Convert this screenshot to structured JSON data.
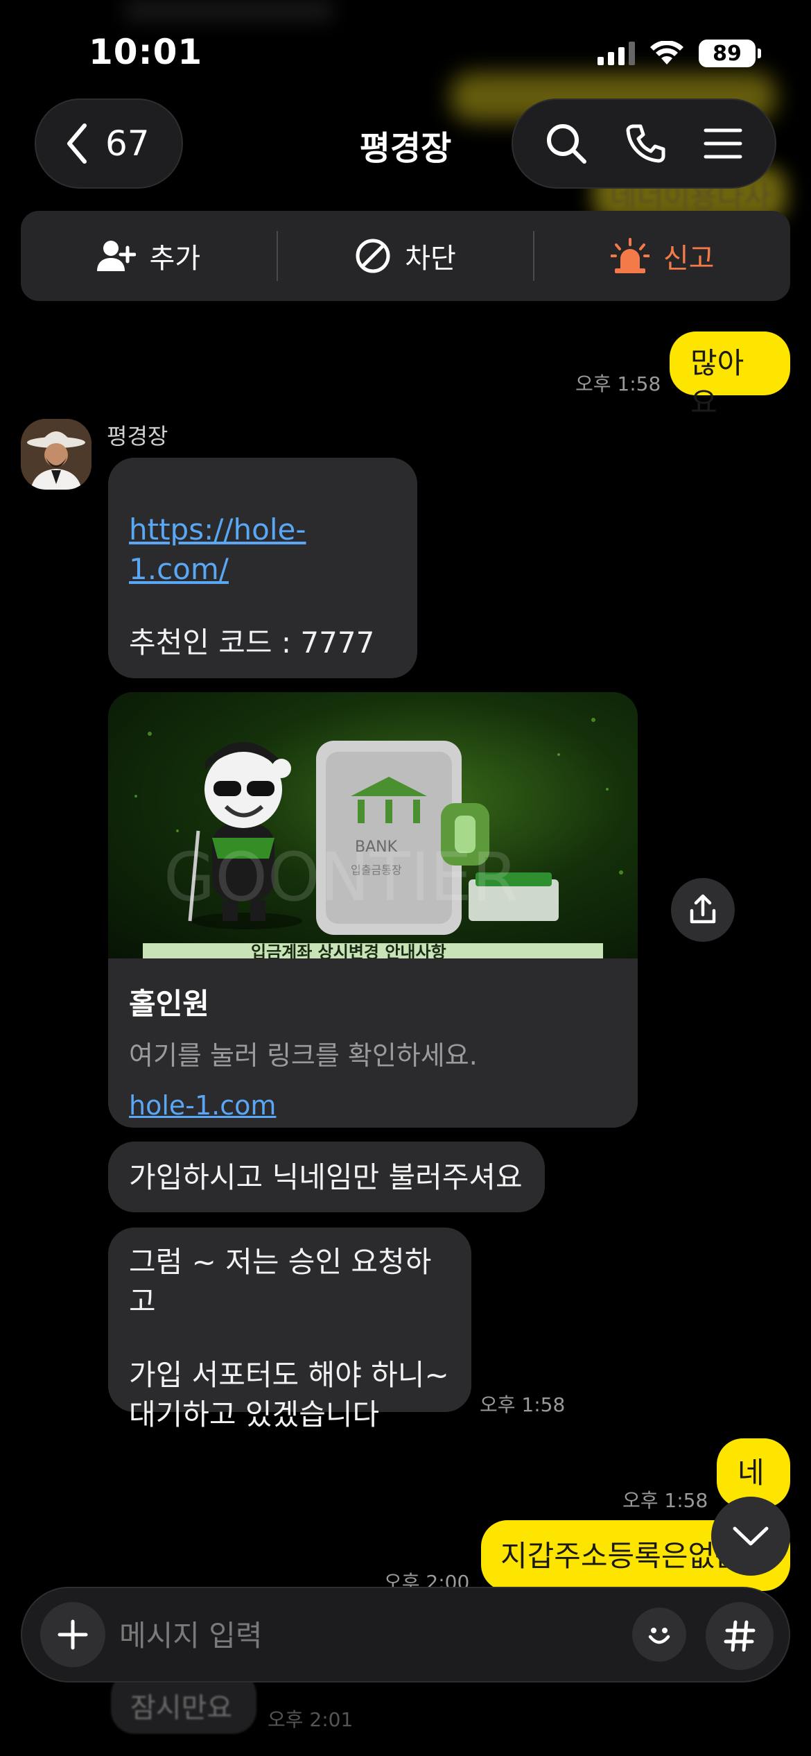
{
  "status_bar": {
    "time": "10:01",
    "battery": "89"
  },
  "header": {
    "back_count": "67",
    "title": "평경장",
    "blurred_text": "데너이용다사"
  },
  "action_bar": {
    "add_label": "추가",
    "block_label": "차단",
    "report_label": "신고"
  },
  "messages": {
    "out_1": {
      "text": "많아요",
      "time": "오후 1:58"
    },
    "sender_name": "평경장",
    "in_1": {
      "link": "https://hole-1.com/",
      "line2": "추천인 코드 :  7777"
    },
    "link_card": {
      "title": "홀인원",
      "description": "여기를 눌러 링크를 확인하세요.",
      "url": "hole-1.com",
      "image_bank_text": "BANK",
      "image_passbook_text": "입출금통장",
      "image_caption": "입금계좌 상시변경 안내사항",
      "image_watermark": "GOONTIER"
    },
    "in_2": {
      "text": "가입하시고 닉네임만 불러주셔요"
    },
    "in_3": {
      "line1": "그럼 ~ 저는 승인 요청하고",
      "line2": "가입 서포터도 해야 하니~",
      "line3": "대기하고 있겠습니다",
      "time": "오후 1:58"
    },
    "out_2": {
      "text": "네",
      "time": "오후 1:58"
    },
    "out_3": {
      "text": "지갑주소등록은없는데",
      "time": "오후 2:00"
    },
    "ghost": {
      "text": "잠시만요",
      "time": "오후 2:01"
    }
  },
  "input": {
    "placeholder": "메시지 입력"
  },
  "colors": {
    "background": "#000000",
    "bubble_in": "#2b2b2d",
    "bubble_out": "#fee500",
    "report_accent": "#f47a4a",
    "link": "#5aa7f5"
  },
  "icons": {
    "back": "chevron-left-icon",
    "search": "search-icon",
    "call": "phone-icon",
    "menu": "menu-icon",
    "add_friend": "add-person-icon",
    "block": "block-icon",
    "report": "siren-icon",
    "share": "share-icon",
    "scroll_down": "chevron-down-icon",
    "plus": "plus-icon",
    "emoji": "emoji-icon",
    "hashtag": "hash-icon"
  }
}
